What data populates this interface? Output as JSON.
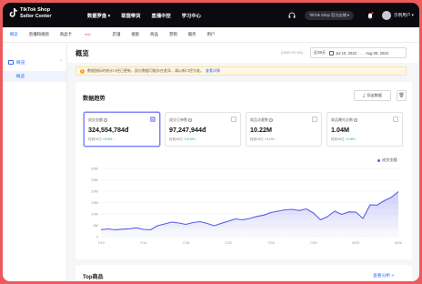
{
  "brand": {
    "name_line1": "TikTok Shop",
    "name_line2": "Seller Center"
  },
  "topnav": [
    "数据罗盘 ▾",
    "联盟带货",
    "直播中控",
    "学习中心"
  ],
  "topbar_right": {
    "shop_selector": "TikTok Shop 官方店铺 ▾",
    "user_name": "示例用户 ▾"
  },
  "subnav": [
    {
      "label": "概览",
      "active": true
    },
    {
      "label": "直播和视频",
      "badge": ""
    },
    {
      "label": "商品卡",
      "badge": "new"
    },
    {
      "label": "店铺"
    },
    {
      "label": "搜索"
    },
    {
      "label": "商品"
    },
    {
      "label": "营销"
    },
    {
      "label": "服务"
    },
    {
      "label": "用户"
    }
  ],
  "sidebar": {
    "group_label": "概览",
    "item_label": "概览"
  },
  "page": {
    "title": "概览",
    "timezone": "(GMT+07:00)",
    "date_prefix": "近28天",
    "date_start": "Jul 10, 2023",
    "date_end": "Aug 06, 2023"
  },
  "notice": {
    "text": "数据指标的统计口径已更新，部分数据可能存在差异，请以新口径为准。",
    "link": "查看详情"
  },
  "trend": {
    "title": "数据趋势",
    "export_label": "导出数据",
    "metrics": [
      {
        "label": "成交金额",
        "value": "324,554,784đ",
        "sub_label": "较前28日",
        "change": "+8.9% ↑",
        "selected": true
      },
      {
        "label": "成交订单数",
        "value": "97,247,944đ",
        "sub_label": "较前28日",
        "change": "+10.6% ↑",
        "selected": false
      },
      {
        "label": "商品访客数",
        "value": "10.22M",
        "sub_label": "较前28日",
        "change": "+4.1% ↑",
        "selected": false
      },
      {
        "label": "商品曝光次数",
        "value": "1.04M",
        "sub_label": "较前28日",
        "change": "+2.8% ↑",
        "selected": false
      }
    ],
    "legend": "成交金额"
  },
  "chart_data": {
    "type": "area",
    "series": [
      {
        "name": "成交金额",
        "color": "#5b5ce6",
        "values": [
          3.1,
          3.4,
          3.0,
          3.3,
          3.5,
          3.9,
          3.2,
          3.0,
          4.8,
          5.6,
          6.4,
          6.0,
          5.4,
          6.2,
          6.6,
          5.8,
          4.8,
          5.9,
          6.8,
          7.8,
          7.4,
          8.0,
          8.9,
          9.5,
          10.6,
          11.2,
          11.8,
          12.0,
          11.5,
          12.2,
          10.4,
          7.4,
          8.8,
          11.2,
          9.8,
          10.9,
          10.8,
          8.0,
          14.0,
          13.9,
          15.8,
          17.3,
          19.8
        ]
      }
    ],
    "y_ticks": [
      "0",
      "5M",
      "10M",
      "15M",
      "20M",
      "25M",
      "30M"
    ],
    "ylim": [
      0,
      30
    ],
    "x_ticks": [
      "7/10",
      "7/14",
      "7/18",
      "7/22",
      "7/26",
      "7/30",
      "8/03",
      "8/06"
    ]
  },
  "top_products": {
    "title": "Top商品",
    "link": "查看分析 >"
  }
}
